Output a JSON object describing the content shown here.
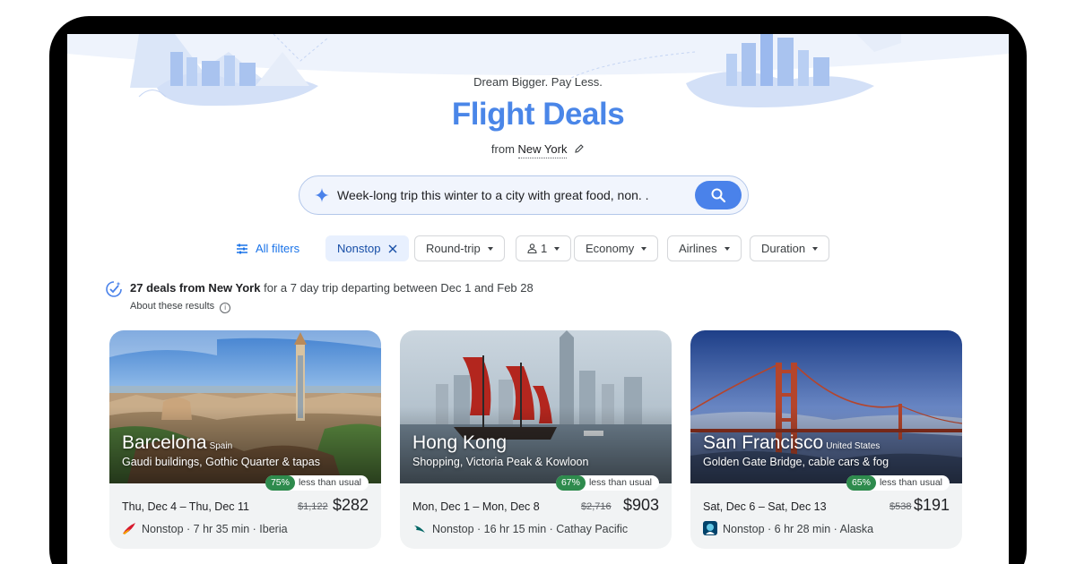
{
  "header": {
    "tagline": "Dream Bigger. Pay Less.",
    "title": "Flight Deals",
    "from_label": "from",
    "from_city": "New York"
  },
  "search": {
    "query": "Week-long trip this winter to a city with great food, non. ."
  },
  "filters": {
    "all_filters": "All filters",
    "chips": [
      {
        "label": "Nonstop",
        "active": true
      },
      {
        "label": "Round-trip"
      },
      {
        "label": "1"
      },
      {
        "label": "Economy"
      },
      {
        "label": "Airlines"
      },
      {
        "label": "Duration"
      }
    ]
  },
  "summary": {
    "bold": "27 deals from New York",
    "rest": " for a 7 day trip departing between Dec 1 and Feb 28",
    "about": "About these results"
  },
  "cards": [
    {
      "city": "Barcelona",
      "country": "Spain",
      "description": "Gaudi buildings, Gothic Quarter & tapas",
      "discount": "75%",
      "discount_label": "less than usual",
      "dates": "Thu, Dec 4 – Thu, Dec 11",
      "old_price": "$1,122",
      "price": "$282",
      "details": "Nonstop · 7 hr 35 min · Iberia",
      "airline_icon": "iberia-logo-icon"
    },
    {
      "city": "Hong Kong",
      "country": "",
      "description": "Shopping, Victoria Peak & Kowloon",
      "discount": "67%",
      "discount_label": "less than usual",
      "dates": "Mon, Dec 1 – Mon, Dec 8",
      "old_price": "$2,716",
      "price": "$903",
      "details": "Nonstop · 16 hr 15 min · Cathay Pacific",
      "airline_icon": "cathay-pacific-logo-icon"
    },
    {
      "city": "San Francisco",
      "country": "United States",
      "description": "Golden Gate Bridge, cable cars & fog",
      "discount": "65%",
      "discount_label": "less than usual",
      "dates": "Sat, Dec 6 – Sat, Dec 13",
      "old_price": "$538",
      "price": "$191",
      "details": "Nonstop · 6 hr 28 min · Alaska",
      "airline_icon": "alaska-logo-icon"
    }
  ],
  "colors": {
    "accent": "#4a86e8",
    "discount_green": "#2e8b4d",
    "chip_active_bg": "#e8f0fe"
  }
}
